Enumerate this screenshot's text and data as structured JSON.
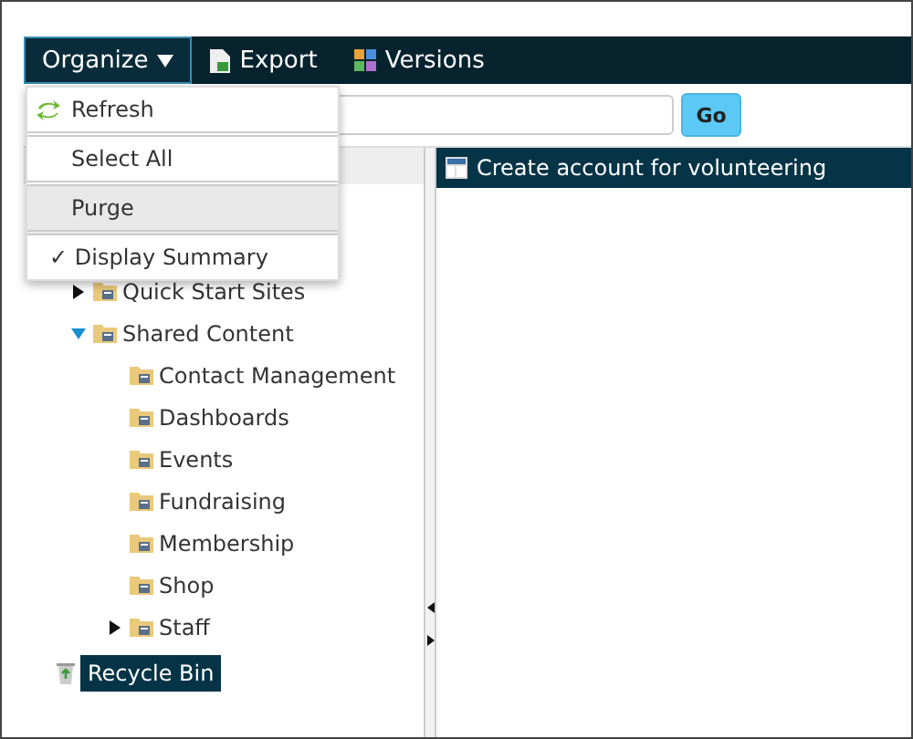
{
  "toolbar": [
    {
      "label": "Organize",
      "kind": "dropdown",
      "open": true
    },
    {
      "label": "Export",
      "kind": "export"
    },
    {
      "label": "Versions",
      "kind": "versions"
    }
  ],
  "menu": [
    {
      "label": "Refresh",
      "kind": "refresh",
      "checked": false,
      "hovered": false
    },
    {
      "label": "Select All",
      "kind": "plain",
      "checked": false,
      "hovered": false
    },
    {
      "label": "Purge",
      "kind": "plain",
      "checked": false,
      "hovered": true
    },
    {
      "label": "Display Summary",
      "kind": "plain",
      "checked": true,
      "hovered": false
    }
  ],
  "check_mark": "✓",
  "search": {
    "button": "Go"
  },
  "tree": [
    {
      "label": "Quick Start Sites",
      "expanded": false
    },
    {
      "label": "Shared Content",
      "expanded": true,
      "children": [
        {
          "label": "Contact Management"
        },
        {
          "label": "Dashboards"
        },
        {
          "label": "Events"
        },
        {
          "label": "Fundraising"
        },
        {
          "label": "Membership"
        },
        {
          "label": "Shop"
        },
        {
          "label": "Staff",
          "expanded": false
        }
      ]
    }
  ],
  "recycle_bin": {
    "label": "Recycle Bin",
    "selected": true
  },
  "content_header": {
    "title": "Create account for volunteering"
  }
}
